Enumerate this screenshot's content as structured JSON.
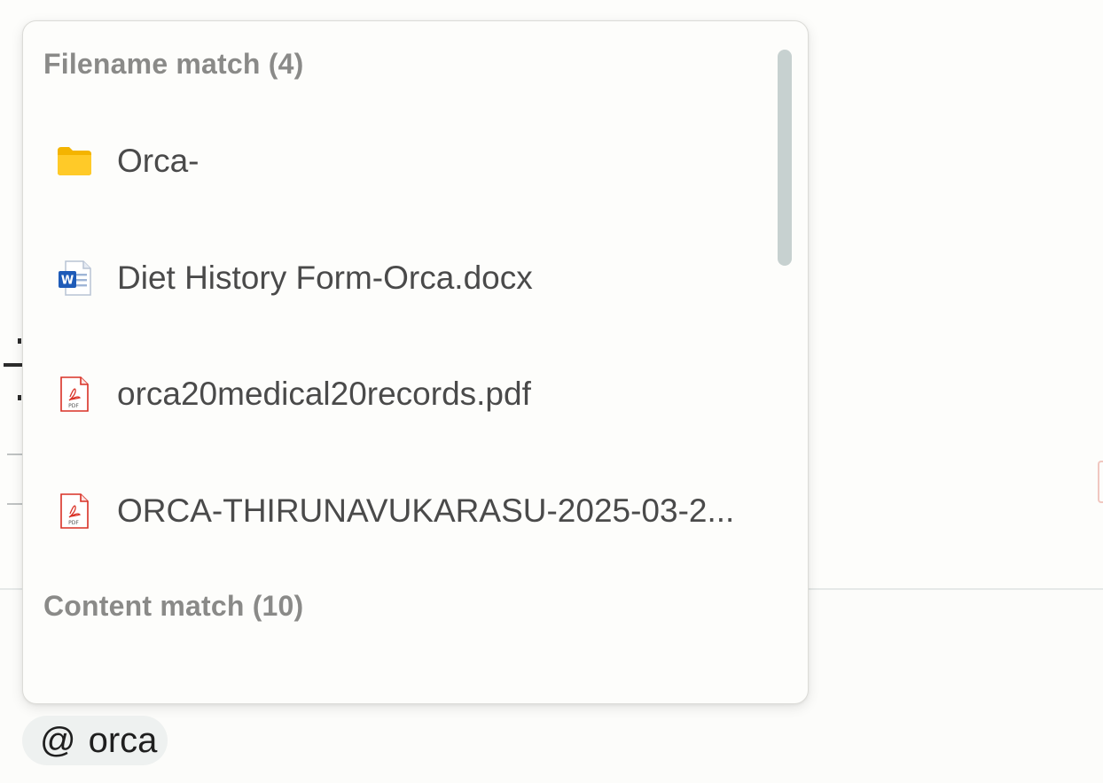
{
  "popup": {
    "filename_section_title": "Filename match (4)",
    "content_section_title": "Content match (10)",
    "items": [
      {
        "label": "Orca-",
        "icon": "folder-icon"
      },
      {
        "label": "Diet History Form-Orca.docx",
        "icon": "word-document-icon"
      },
      {
        "label": "orca20medical20records.pdf",
        "icon": "pdf-icon"
      },
      {
        "label": "ORCA-THIRUNAVUKARASU-2025-03-2...",
        "icon": "pdf-icon"
      }
    ]
  },
  "mention": {
    "symbol": "@",
    "query": "orca"
  },
  "colors": {
    "folder": "#FBC02D",
    "word": "#1E5BB8",
    "pdf": "#D93025",
    "section_title": "#8a8a88",
    "scrollbar": "#c7d1d0"
  }
}
